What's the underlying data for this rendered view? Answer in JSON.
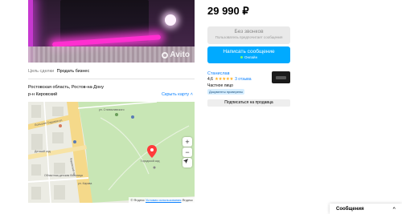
{
  "listing": {
    "photo_watermark": "Avito",
    "deal_label": "Цель сделки",
    "deal_value": "Продать бизнес",
    "address_line1": "Ростовская область, Ростов-на-Дону",
    "address_line2": "р-н Кировский",
    "hide_map_label": "Скрыть карту",
    "hide_map_chevron": "˄"
  },
  "map": {
    "zoom_in": "+",
    "zoom_out": "−",
    "locate_icon": "locate-arrow",
    "footer_logo": "© Яндекс",
    "footer_terms": "Условия использования",
    "footer_maps": "Яндекс",
    "labels": [
      "Большая Садовая ул.",
      "ул. Станиславского",
      "Городской сад",
      "Кировский пр.",
      "Детский сад",
      "Областная детская больница",
      "ул. Кирова"
    ],
    "colors": {
      "park": "#c8e6b5",
      "road": "#f5d98a",
      "pin": "#ff3b3b"
    }
  },
  "sidebar": {
    "price": "29 990 ₽",
    "no_calls_label": "Без звонков",
    "no_calls_sub": "Пользователь предпочитает сообщения",
    "write_label": "Написать сообщение",
    "write_sub": "Онлайн",
    "seller_name": "Станислав",
    "rating": "4,6",
    "stars": "★★★★★",
    "reviews": "3 отзыва",
    "seller_type": "Частное лицо",
    "verified_badge": "Документы проверены",
    "subscribe_label": "Подписаться на продавца"
  },
  "messages": {
    "label": "Сообщения",
    "chevron": "^"
  }
}
